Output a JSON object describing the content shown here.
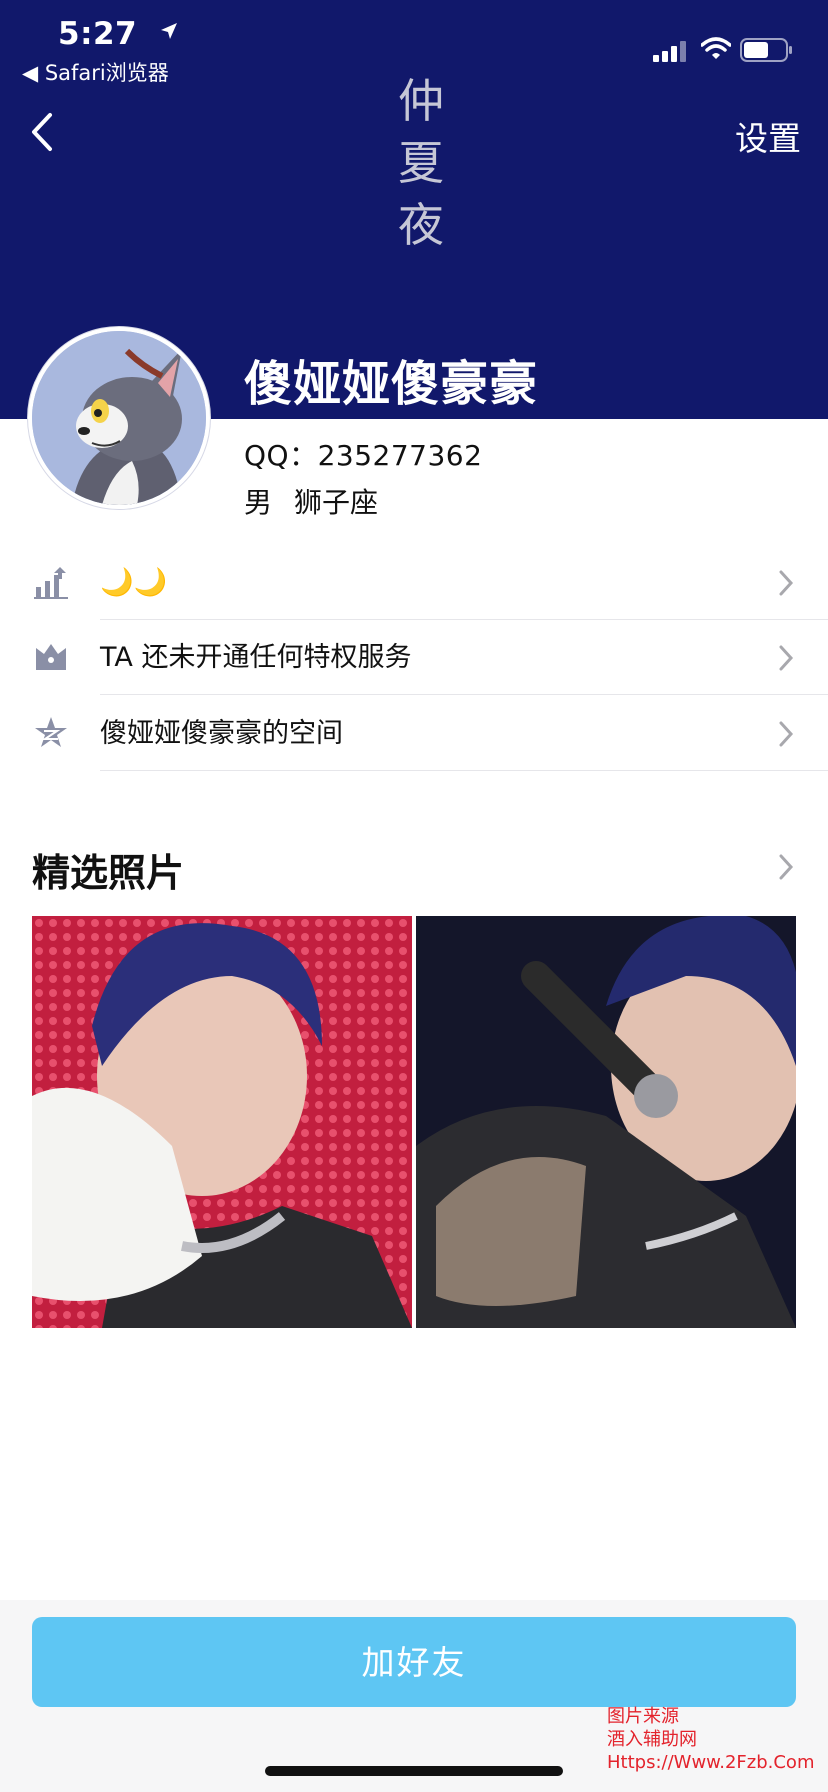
{
  "status_bar": {
    "time": "5:27",
    "back_app": "◀ Safari浏览器"
  },
  "nav": {
    "settings_label": "设置"
  },
  "cover": {
    "chars": [
      "仲",
      "夏",
      "夜"
    ]
  },
  "profile": {
    "nickname": "傻娅娅傻豪豪",
    "qq": "QQ：235277362",
    "gender": "男",
    "zodiac": "狮子座"
  },
  "rows": [
    {
      "icon": "level-chart-icon",
      "label": "🌙🌙"
    },
    {
      "icon": "crown-icon",
      "label": "TA 还未开通任何特权服务"
    },
    {
      "icon": "star-icon",
      "label": "傻娅娅傻豪豪的空间"
    }
  ],
  "photos_section": {
    "title": "精选照片"
  },
  "actions": {
    "add_friend_label": "加好友"
  },
  "watermark": {
    "line1": "图片来源",
    "line2": "酒入辅助网",
    "line3": "Https://Www.2Fzb.Com"
  },
  "colors": {
    "header_bg": "#11186b",
    "button_bg": "#5ec6f3",
    "watermark": "#e3232c"
  }
}
